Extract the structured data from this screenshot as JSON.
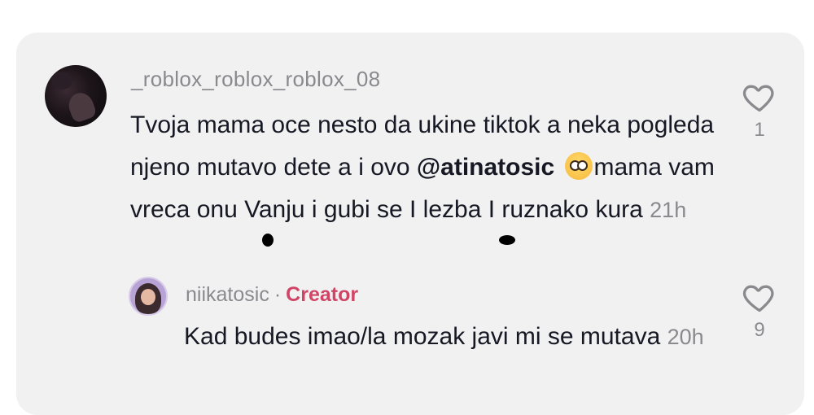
{
  "comment": {
    "username": "_roblox_roblox_roblox_08",
    "text_before_mention": "Tvoja mama oce nesto da ukine tiktok a neka pogleda njeno mutavo dete a i ovo ",
    "mention": "@atinatosic",
    "emoji_icon": "flushed-face-emoji",
    "text_after_emoji": "mama vam vreca onu Vanju i gubi se I lezba I ruznako kura",
    "time": "21h",
    "likes": "1"
  },
  "reply": {
    "username": "niikatosic",
    "separator": "·",
    "badge": "Creator",
    "text": "Kad budes imao/la mozak javi mi se mutava",
    "time": "20h",
    "likes": "9"
  },
  "colors": {
    "card_background": "#f1f1f2",
    "creator_badge": "#d14466",
    "secondary_text": "#8a8a8e",
    "primary_text": "#161823"
  }
}
